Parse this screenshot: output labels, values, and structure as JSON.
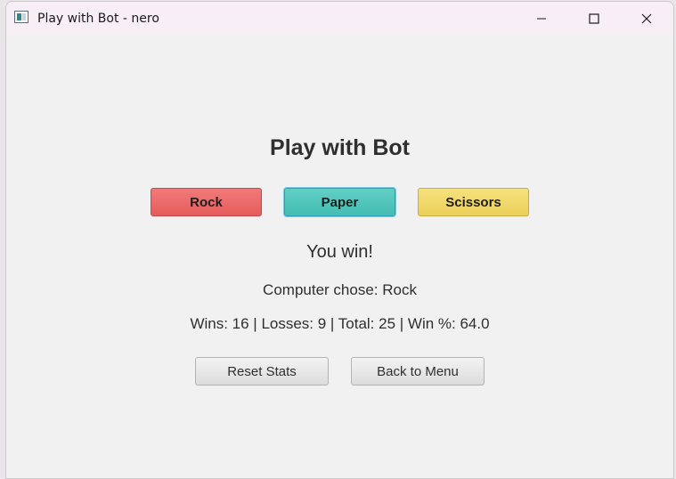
{
  "window": {
    "title": "Play with Bot - nero",
    "icon": "app-window-icon"
  },
  "title_controls": {
    "minimize_icon": "minimize-icon",
    "maximize_icon": "maximize-icon",
    "close_icon": "close-icon"
  },
  "game": {
    "heading": "Play with Bot",
    "choices": [
      {
        "label": "Rock",
        "color": "#e96262"
      },
      {
        "label": "Paper",
        "color": "#4cc4b9"
      },
      {
        "label": "Scissors",
        "color": "#f0d666"
      }
    ],
    "result": "You win!",
    "computer_choice": "Computer chose: Rock",
    "stats": "Wins: 16 | Losses: 9 | Total: 25 | Win %: 64.0"
  },
  "actions": {
    "reset_label": "Reset Stats",
    "back_label": "Back to Menu"
  }
}
